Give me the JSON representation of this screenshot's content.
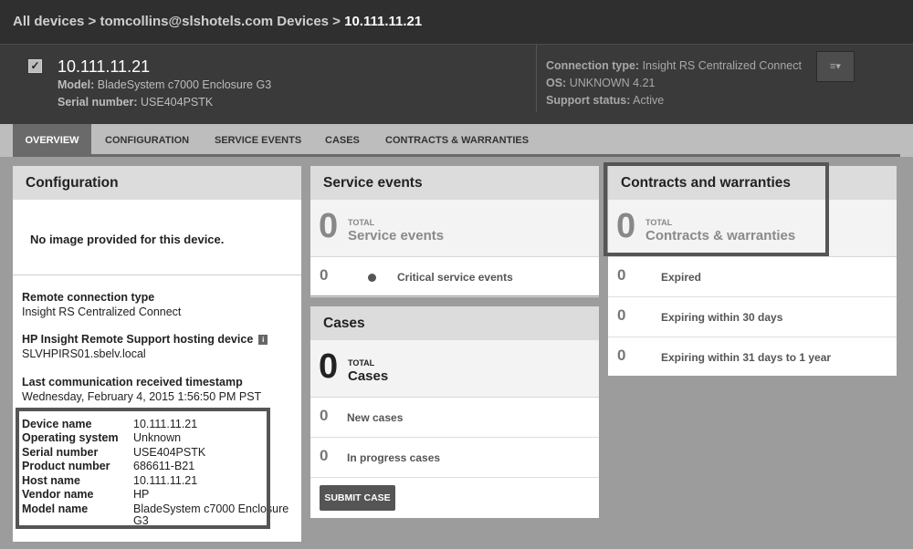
{
  "breadcrumb": {
    "path": "All devices > tomcollins@slshotels.com Devices > ",
    "current": "10.111.11.21"
  },
  "device": {
    "title": "10.111.11.21",
    "model_label": "Model:",
    "model_value": "BladeSystem c7000 Enclosure G3",
    "serial_label": "Serial number:",
    "serial_value": "USE404PSTK",
    "connection_label": "Connection type:",
    "connection_value": "Insight RS Centralized Connect",
    "os_label": "OS:",
    "os_value": "UNKNOWN 4.21",
    "support_label": "Support status:",
    "support_value": "Active",
    "checkbox_glyph": "✓",
    "menu_glyph": "≡▾"
  },
  "tabs": [
    {
      "label": "OVERVIEW",
      "active": true
    },
    {
      "label": "CONFIGURATION",
      "active": false
    },
    {
      "label": "SERVICE EVENTS",
      "active": false
    },
    {
      "label": "CASES",
      "active": false
    },
    {
      "label": "CONTRACTS & WARRANTIES",
      "active": false
    }
  ],
  "configuration": {
    "heading": "Configuration",
    "no_image": "No image provided for this device.",
    "remote_type_label": "Remote connection type",
    "remote_type_value": "Insight RS Centralized Connect",
    "hosting_label": "HP Insight Remote Support hosting device",
    "hosting_value": "SLVHPIRS01.sbelv.local",
    "info_glyph": "i",
    "last_comm_label": "Last communication received timestamp",
    "last_comm_value": "Wednesday, February 4, 2015 1:56:50 PM PST",
    "details": [
      {
        "key": "Device name",
        "value": "10.111.11.21"
      },
      {
        "key": "Operating system",
        "value": "Unknown"
      },
      {
        "key": "Serial number",
        "value": "USE404PSTK"
      },
      {
        "key": "Product number",
        "value": "686611-B21"
      },
      {
        "key": "Host name",
        "value": "10.111.11.21"
      },
      {
        "key": "Vendor name",
        "value": "HP"
      },
      {
        "key": "Model name",
        "value": "BladeSystem c7000 Enclosure G3"
      }
    ]
  },
  "service_events": {
    "heading": "Service events",
    "total_num": "0",
    "total_small": "TOTAL",
    "total_big": "Service events",
    "rows": [
      {
        "num": "0",
        "label": "Critical service events"
      }
    ]
  },
  "cases": {
    "heading": "Cases",
    "total_num": "0",
    "total_small": "TOTAL",
    "total_big": "Cases",
    "rows": [
      {
        "num": "0",
        "label": "New cases"
      },
      {
        "num": "0",
        "label": "In progress cases"
      }
    ],
    "submit_label": "SUBMIT CASE"
  },
  "contracts": {
    "heading": "Contracts and warranties",
    "total_num": "0",
    "total_small": "TOTAL",
    "total_big": "Contracts & warranties",
    "rows": [
      {
        "num": "0",
        "label": "Expired"
      },
      {
        "num": "0",
        "label": "Expiring within 30 days"
      },
      {
        "num": "0",
        "label": "Expiring within 31 days to 1 year"
      }
    ]
  }
}
